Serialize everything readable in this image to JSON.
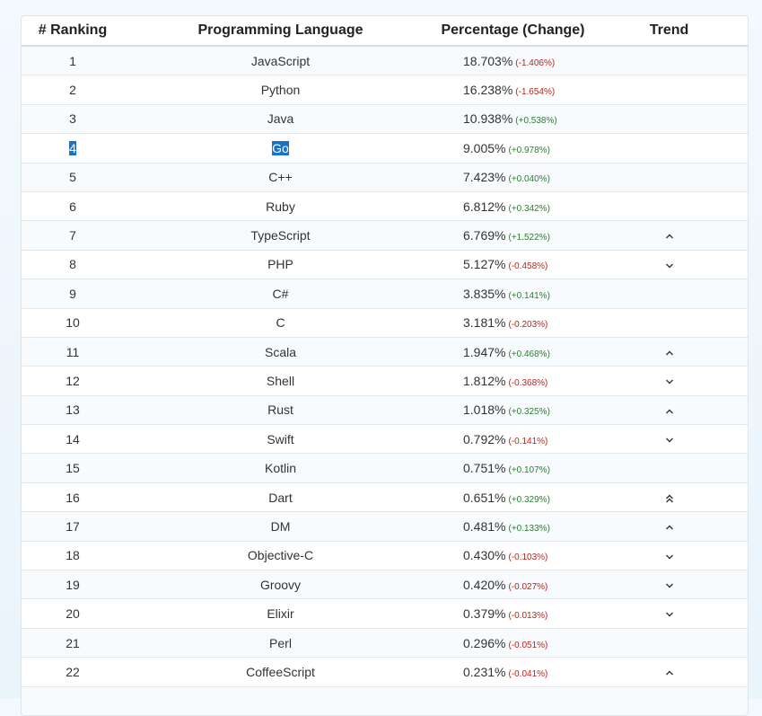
{
  "headers": {
    "rank": "# Ranking",
    "language": "Programming Language",
    "percentage": "Percentage (Change)",
    "trend": "Trend"
  },
  "rows": [
    {
      "rank": "1",
      "language": "JavaScript",
      "percent": "18.703%",
      "change": "(-1.406%)",
      "trend": ""
    },
    {
      "rank": "2",
      "language": "Python",
      "percent": "16.238%",
      "change": "(-1.654%)",
      "trend": ""
    },
    {
      "rank": "3",
      "language": "Java",
      "percent": "10.938%",
      "change": "(+0.538%)",
      "trend": ""
    },
    {
      "rank": "4",
      "language": "Go",
      "percent": "9.005%",
      "change": "(+0.978%)",
      "trend": "",
      "selected": true
    },
    {
      "rank": "5",
      "language": "C++",
      "percent": "7.423%",
      "change": "(+0.040%)",
      "trend": ""
    },
    {
      "rank": "6",
      "language": "Ruby",
      "percent": "6.812%",
      "change": "(+0.342%)",
      "trend": ""
    },
    {
      "rank": "7",
      "language": "TypeScript",
      "percent": "6.769%",
      "change": "(+1.522%)",
      "trend": "up"
    },
    {
      "rank": "8",
      "language": "PHP",
      "percent": "5.127%",
      "change": "(-0.458%)",
      "trend": "down"
    },
    {
      "rank": "9",
      "language": "C#",
      "percent": "3.835%",
      "change": "(+0.141%)",
      "trend": ""
    },
    {
      "rank": "10",
      "language": "C",
      "percent": "3.181%",
      "change": "(-0.203%)",
      "trend": ""
    },
    {
      "rank": "11",
      "language": "Scala",
      "percent": "1.947%",
      "change": "(+0.468%)",
      "trend": "up"
    },
    {
      "rank": "12",
      "language": "Shell",
      "percent": "1.812%",
      "change": "(-0.368%)",
      "trend": "down"
    },
    {
      "rank": "13",
      "language": "Rust",
      "percent": "1.018%",
      "change": "(+0.325%)",
      "trend": "up"
    },
    {
      "rank": "14",
      "language": "Swift",
      "percent": "0.792%",
      "change": "(-0.141%)",
      "trend": "down"
    },
    {
      "rank": "15",
      "language": "Kotlin",
      "percent": "0.751%",
      "change": "(+0.107%)",
      "trend": ""
    },
    {
      "rank": "16",
      "language": "Dart",
      "percent": "0.651%",
      "change": "(+0.329%)",
      "trend": "double-up"
    },
    {
      "rank": "17",
      "language": "DM",
      "percent": "0.481%",
      "change": "(+0.133%)",
      "trend": "up"
    },
    {
      "rank": "18",
      "language": "Objective-C",
      "percent": "0.430%",
      "change": "(-0.103%)",
      "trend": "down"
    },
    {
      "rank": "19",
      "language": "Groovy",
      "percent": "0.420%",
      "change": "(-0.027%)",
      "trend": "down"
    },
    {
      "rank": "20",
      "language": "Elixir",
      "percent": "0.379%",
      "change": "(-0.013%)",
      "trend": "down"
    },
    {
      "rank": "21",
      "language": "Perl",
      "percent": "0.296%",
      "change": "(-0.051%)",
      "trend": ""
    },
    {
      "rank": "22",
      "language": "CoffeeScript",
      "percent": "0.231%",
      "change": "(-0.041%)",
      "trend": "up"
    },
    {
      "rank": "",
      "language": "",
      "percent": "",
      "change": "",
      "trend": ""
    }
  ]
}
